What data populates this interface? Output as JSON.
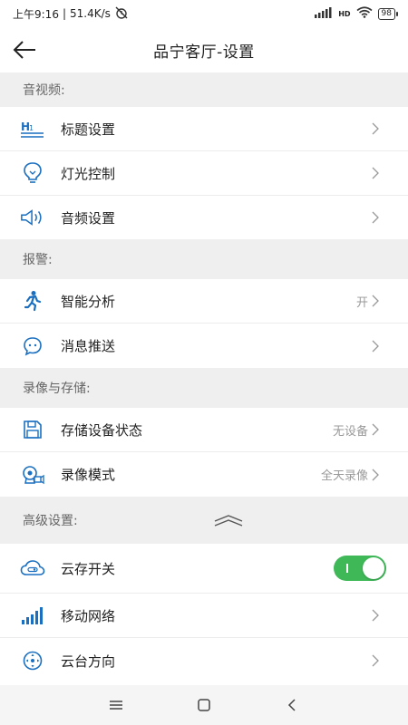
{
  "status": {
    "time": "上午9:16",
    "speed": "51.4K/s",
    "network": "HD",
    "battery": "98"
  },
  "header": {
    "title": "品宁客厅-设置"
  },
  "sections": {
    "av": {
      "title": "音视频:",
      "items": [
        {
          "label": "标题设置",
          "icon": "title-h1-icon"
        },
        {
          "label": "灯光控制",
          "icon": "light-bulb-icon"
        },
        {
          "label": "音频设置",
          "icon": "speaker-icon"
        }
      ]
    },
    "alarm": {
      "title": "报警:",
      "items": [
        {
          "label": "智能分析",
          "value": "开",
          "icon": "running-person-icon"
        },
        {
          "label": "消息推送",
          "icon": "chat-bubble-icon"
        }
      ]
    },
    "storage": {
      "title": "录像与存储:",
      "items": [
        {
          "label": "存储设备状态",
          "value": "无设备",
          "icon": "floppy-disk-icon"
        },
        {
          "label": "录像模式",
          "value": "全天录像",
          "icon": "camera-record-icon"
        }
      ]
    },
    "advanced": {
      "title": "高级设置:",
      "items": [
        {
          "label": "云存开关",
          "icon": "cloud-icon",
          "toggle": "on"
        },
        {
          "label": "移动网络",
          "icon": "signal-bars-icon"
        },
        {
          "label": "云台方向",
          "icon": "ptz-direction-icon"
        }
      ]
    }
  },
  "colors": {
    "accent": "#1a6fc0",
    "toggle_on": "#3fb858",
    "section_bg": "#efefef"
  }
}
